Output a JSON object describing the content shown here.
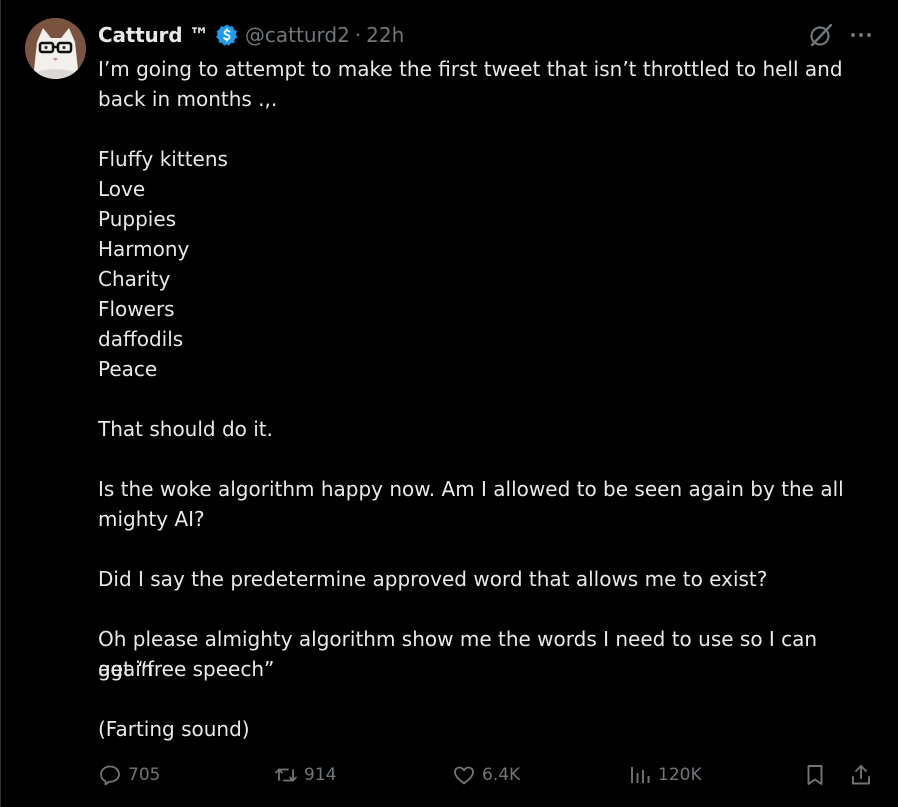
{
  "author": {
    "display_name": "Catturd ™",
    "handle": "@catturd2",
    "separator": "·",
    "time": "22h",
    "verified_icon": "verified-badge-icon",
    "verified_color": "#1d9bf0",
    "avatar": "avatar-cat-with-glasses"
  },
  "header_actions": {
    "grok_icon": "grok-icon",
    "more_icon": "more-dots-icon"
  },
  "body_lines": [
    "I’m going to attempt to make the first tweet that isn’t throttled to hell and",
    "back in months .,.",
    "",
    "Fluffy kittens",
    "Love",
    "Puppies",
    "Harmony",
    "Charity",
    "Flowers",
    "daffodils",
    "Peace",
    "",
    "That should do it.",
    "",
    "Is the woke algorithm happy now. Am I allowed to be seen again by the all",
    "mighty AI?",
    "",
    "Did I say the predetermine approved word that allows me to exist?",
    "",
    "Oh please almighty algorithm show me the words I need to use so I can again",
    "get “free speech”",
    "",
    "(Farting sound)"
  ],
  "stats": {
    "replies": "705",
    "retweets": "914",
    "likes": "6.4K",
    "views": "120K"
  },
  "icons": {
    "reply": "reply-icon",
    "retweet": "retweet-icon",
    "like": "heart-icon",
    "views": "views-chart-icon",
    "bookmark": "bookmark-icon",
    "share": "share-icon"
  },
  "colors": {
    "background": "#000000",
    "text": "#e7e9ea",
    "secondary": "#71767b",
    "accent": "#1d9bf0"
  }
}
